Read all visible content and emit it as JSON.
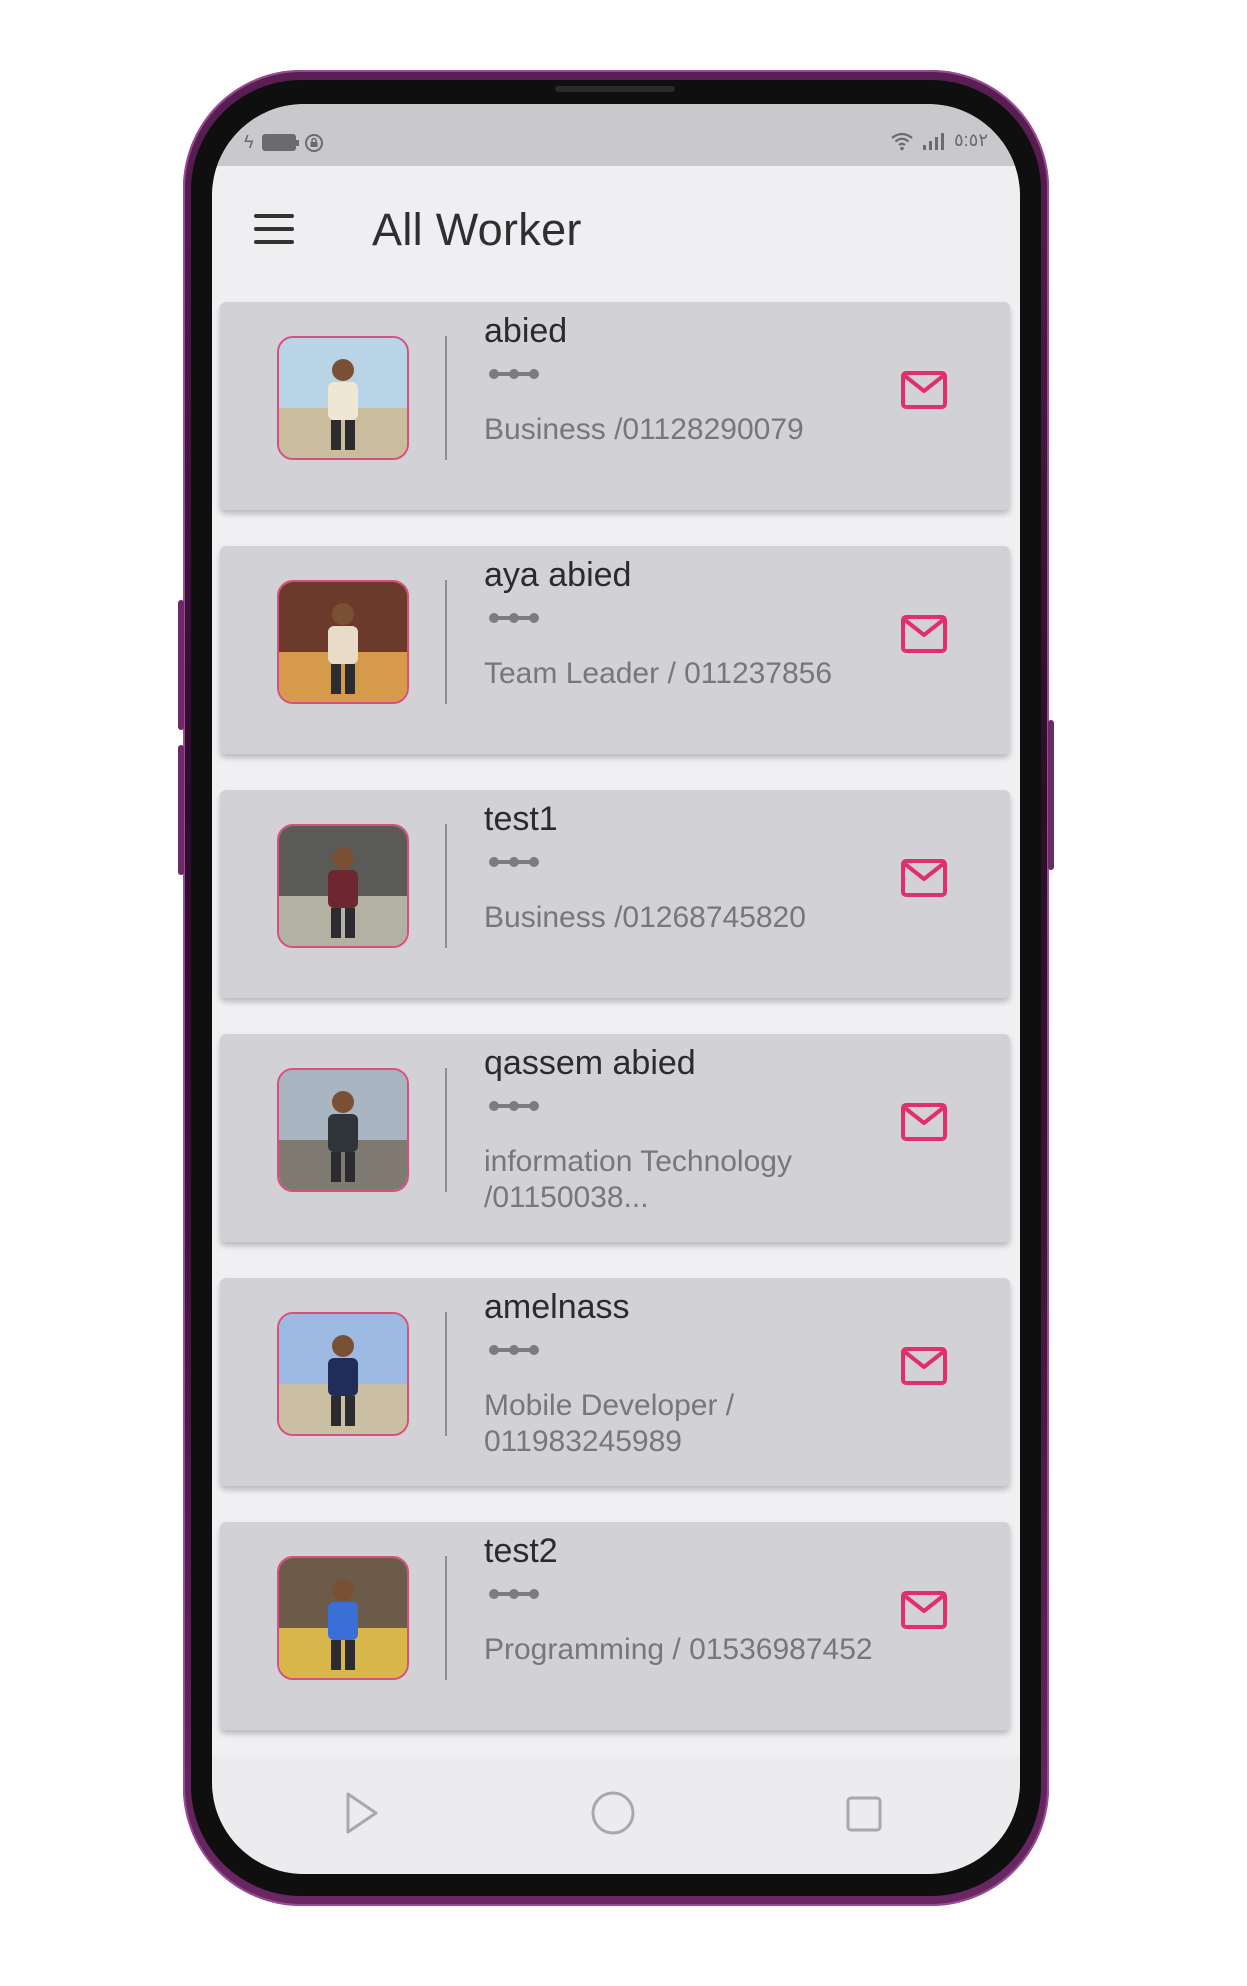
{
  "statusbar": {
    "time": "٥:٥٢"
  },
  "appbar": {
    "title": "All Worker",
    "menu_icon": "hamburger-icon"
  },
  "accent_color": "#e0306a",
  "workers": [
    {
      "name": "abied",
      "subtitle": "Business /01128290079",
      "dots_icon": "more-horizontal-icon",
      "action_icon": "mail-icon",
      "avatar": {
        "sky": "#b9d4e6",
        "ground": "#c9bd9e",
        "shirt": "#efe6d4"
      }
    },
    {
      "name": "aya abied",
      "subtitle": "Team Leader / 011237856",
      "dots_icon": "more-horizontal-icon",
      "action_icon": "mail-icon",
      "avatar": {
        "sky": "#6b3a2a",
        "ground": "#d59a4c",
        "shirt": "#e8dcc8"
      }
    },
    {
      "name": "test1",
      "subtitle": "Business /01268745820",
      "dots_icon": "more-horizontal-icon",
      "action_icon": "mail-icon",
      "avatar": {
        "sky": "#5a5a58",
        "ground": "#b3b0a4",
        "shirt": "#6e2630"
      }
    },
    {
      "name": "qassem abied",
      "subtitle": "information Technology  /01150038...",
      "dots_icon": "more-horizontal-icon",
      "action_icon": "mail-icon",
      "avatar": {
        "sky": "#a9b5c0",
        "ground": "#7e7a6f",
        "shirt": "#2e3438"
      }
    },
    {
      "name": "amelnass",
      "subtitle": "Mobile Developer / 011983245989",
      "dots_icon": "more-horizontal-icon",
      "action_icon": "mail-icon",
      "avatar": {
        "sky": "#9dbbe2",
        "ground": "#cbbfa4",
        "shirt": "#1f2d58"
      }
    },
    {
      "name": "test2",
      "subtitle": "Programming / 01536987452",
      "dots_icon": "more-horizontal-icon",
      "action_icon": "mail-icon",
      "avatar": {
        "sky": "#6b5b48",
        "ground": "#d8b64a",
        "shirt": "#3a6fd8"
      }
    }
  ],
  "navbar": {
    "back_icon": "play-back-icon",
    "home_icon": "home-circle-icon",
    "recents_icon": "recents-square-icon"
  }
}
